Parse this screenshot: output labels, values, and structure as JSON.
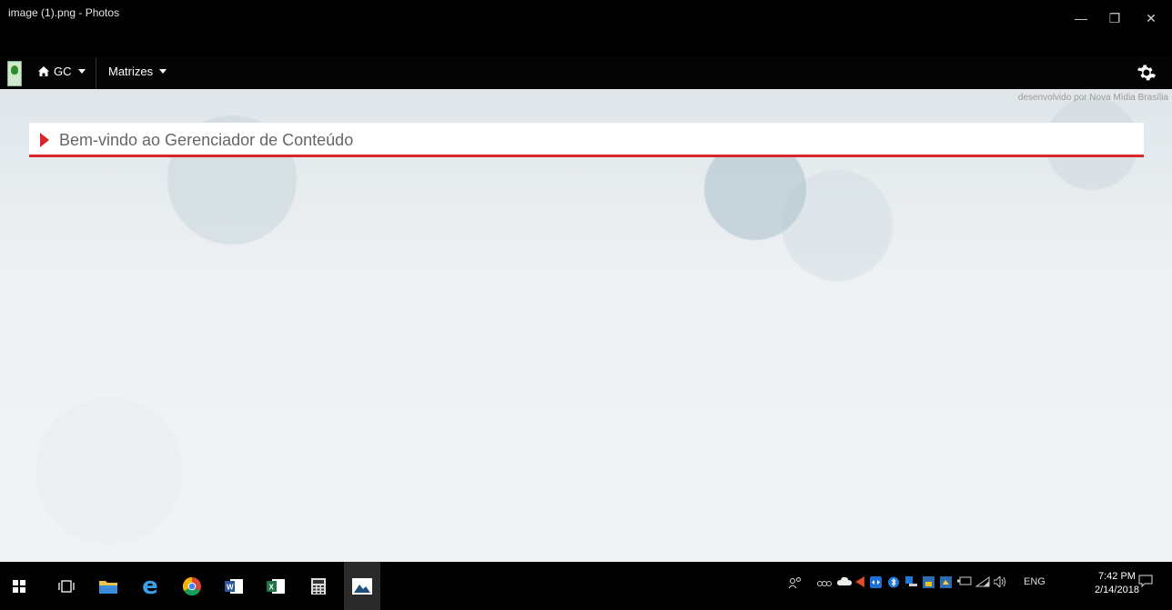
{
  "window": {
    "title": "image (1).png - Photos",
    "minimize_glyph": "—",
    "restore_glyph": "❐",
    "close_glyph": "✕"
  },
  "navbar": {
    "home_label": "GC",
    "matrizes_label": "Matrizes"
  },
  "content": {
    "credit": "desenvolvido por Nova Mídia Brasília",
    "welcome": "Bem-vindo ao Gerenciador de Conteúdo",
    "accent_color": "#d9262b"
  },
  "taskbar": {
    "apps": [
      "start-icon",
      "task-view-icon",
      "file-explorer-icon",
      "edge-icon",
      "chrome-icon",
      "word-icon",
      "excel-icon",
      "calculator-icon",
      "photos-icon"
    ],
    "language": "ENG",
    "time": "7:42 PM",
    "date": "2/14/2018"
  }
}
